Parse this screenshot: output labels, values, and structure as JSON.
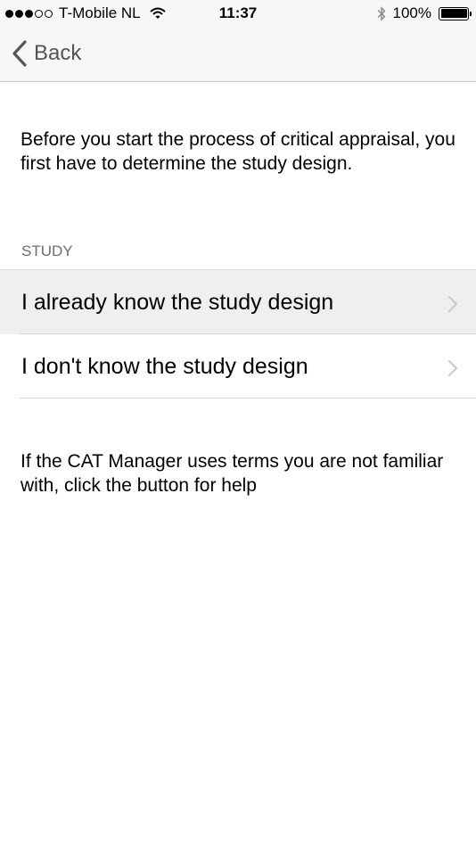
{
  "status_bar": {
    "carrier": "T-Mobile NL",
    "time": "11:37",
    "battery": "100%",
    "signal_bars_filled": 3,
    "signal_bars_total": 5
  },
  "nav": {
    "back_label": "Back"
  },
  "intro_text": "Before you start the process of critical appraisal, you first have to determine the study design.",
  "section_header": "STUDY",
  "options": [
    {
      "label": "I already know the study design"
    },
    {
      "label": "I don't know the study design"
    }
  ],
  "help_text": "If the CAT Manager uses terms you are not familiar with, click the button for help",
  "colors": {
    "nav_background": "#f7f7f7",
    "highlighted_row": "#efefef",
    "section_header_text": "#6d6d72",
    "chevron": "#c7c7cc"
  }
}
